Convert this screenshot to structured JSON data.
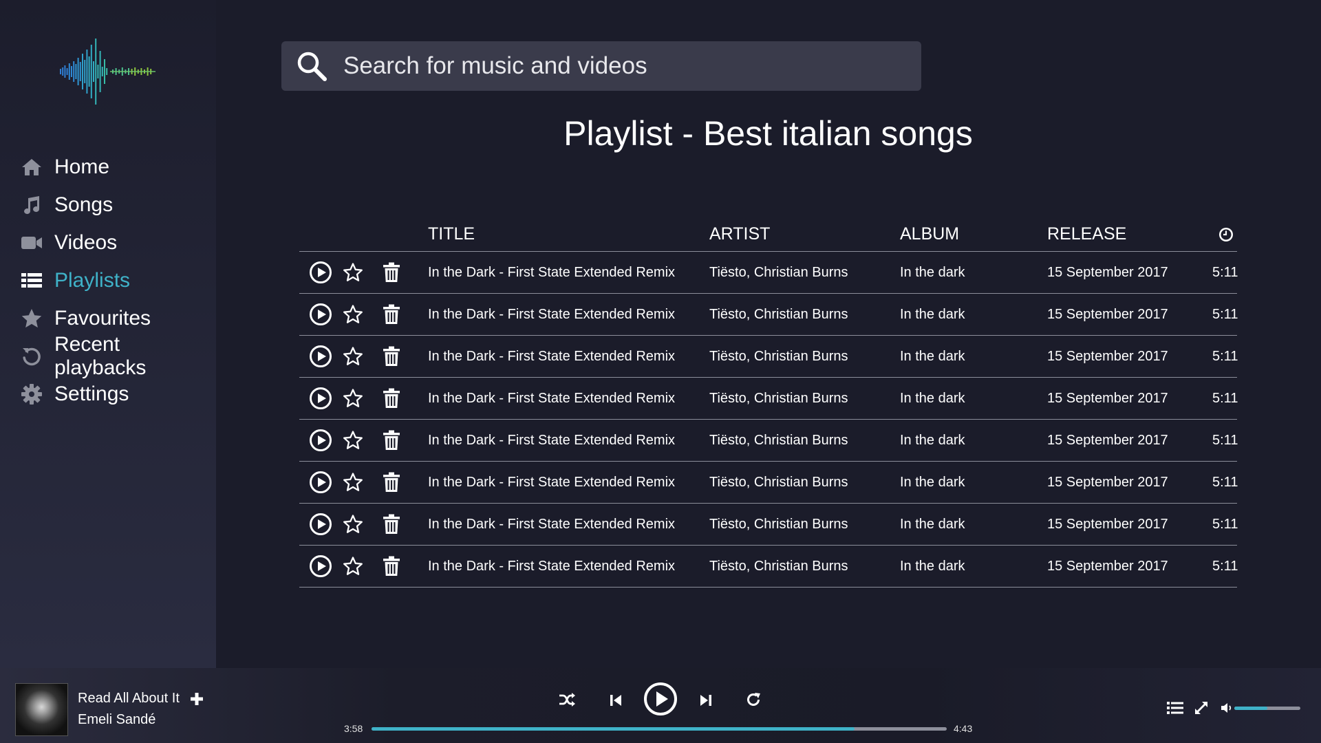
{
  "app": {
    "accent_color": "#3fb2c8",
    "background_color": "#1b1c2a"
  },
  "logo": {
    "icon": "waveform-logo-icon"
  },
  "sidebar": {
    "items": [
      {
        "label": "Home",
        "icon": "home-icon",
        "active": false
      },
      {
        "label": "Songs",
        "icon": "music-note-icon",
        "active": false
      },
      {
        "label": "Videos",
        "icon": "video-camera-icon",
        "active": false
      },
      {
        "label": "Playlists",
        "icon": "list-icon",
        "active": true
      },
      {
        "label": "Favourites",
        "icon": "star-icon",
        "active": false
      },
      {
        "label": "Recent playbacks",
        "icon": "history-icon",
        "active": false
      },
      {
        "label": "Settings",
        "icon": "gear-icon",
        "active": false
      }
    ]
  },
  "search": {
    "placeholder": "Search for music and videos",
    "value": ""
  },
  "page": {
    "title": "Playlist - Best italian songs"
  },
  "table": {
    "columns": {
      "title": "TITLE",
      "artist": "ARTIST",
      "album": "ALBUM",
      "release": "RELEASE",
      "duration_icon": "clock-icon"
    },
    "rows": [
      {
        "title": "In the Dark - First State Extended Remix",
        "artist": "Tiësto, Christian Burns",
        "album": "In the dark",
        "release": "15 September 2017",
        "duration": "5:11"
      },
      {
        "title": "In the Dark - First State Extended Remix",
        "artist": "Tiësto, Christian Burns",
        "album": "In the dark",
        "release": "15 September 2017",
        "duration": "5:11"
      },
      {
        "title": "In the Dark - First State Extended Remix",
        "artist": "Tiësto, Christian Burns",
        "album": "In the dark",
        "release": "15 September 2017",
        "duration": "5:11"
      },
      {
        "title": "In the Dark - First State Extended Remix",
        "artist": "Tiësto, Christian Burns",
        "album": "In the dark",
        "release": "15 September 2017",
        "duration": "5:11"
      },
      {
        "title": "In the Dark - First State Extended Remix",
        "artist": "Tiësto, Christian Burns",
        "album": "In the dark",
        "release": "15 September 2017",
        "duration": "5:11"
      },
      {
        "title": "In the Dark - First State Extended Remix",
        "artist": "Tiësto, Christian Burns",
        "album": "In the dark",
        "release": "15 September 2017",
        "duration": "5:11"
      },
      {
        "title": "In the Dark - First State Extended Remix",
        "artist": "Tiësto, Christian Burns",
        "album": "In the dark",
        "release": "15 September 2017",
        "duration": "5:11"
      },
      {
        "title": "In the Dark - First State Extended Remix",
        "artist": "Tiësto, Christian Burns",
        "album": "In the dark",
        "release": "15 September 2017",
        "duration": "5:11"
      }
    ],
    "row_action_icons": [
      "play-circle-icon",
      "star-outline-icon",
      "trash-icon"
    ]
  },
  "player": {
    "track_title": "Read All About It",
    "track_artist": "Emeli Sandé",
    "elapsed": "3:58",
    "total": "4:43",
    "progress_fraction": 0.84,
    "volume_fraction": 0.5,
    "icons": [
      "shuffle-icon",
      "previous-icon",
      "play-circle-icon",
      "next-icon",
      "repeat-icon",
      "queue-icon",
      "fullscreen-icon",
      "volume-icon",
      "add-icon"
    ]
  }
}
